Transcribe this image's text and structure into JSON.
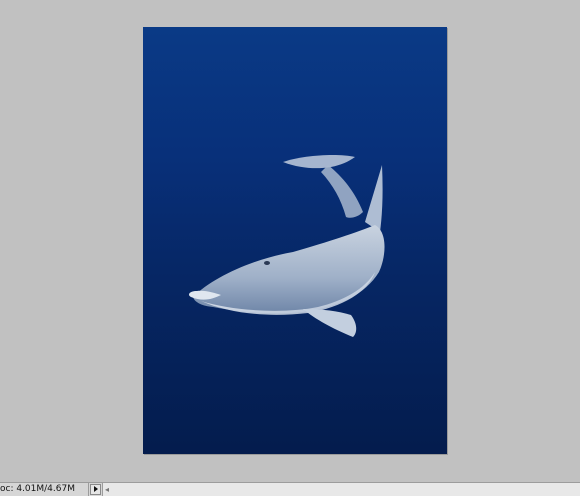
{
  "statusbar": {
    "doc_size": "oc: 4.01M/4.67M",
    "arrow_icon": "triangle-right-icon",
    "scroll_left_glyph": "◂"
  },
  "document": {
    "content": "dolphin-image",
    "background_top": "#0a3a86",
    "background_bottom": "#041c4d"
  }
}
